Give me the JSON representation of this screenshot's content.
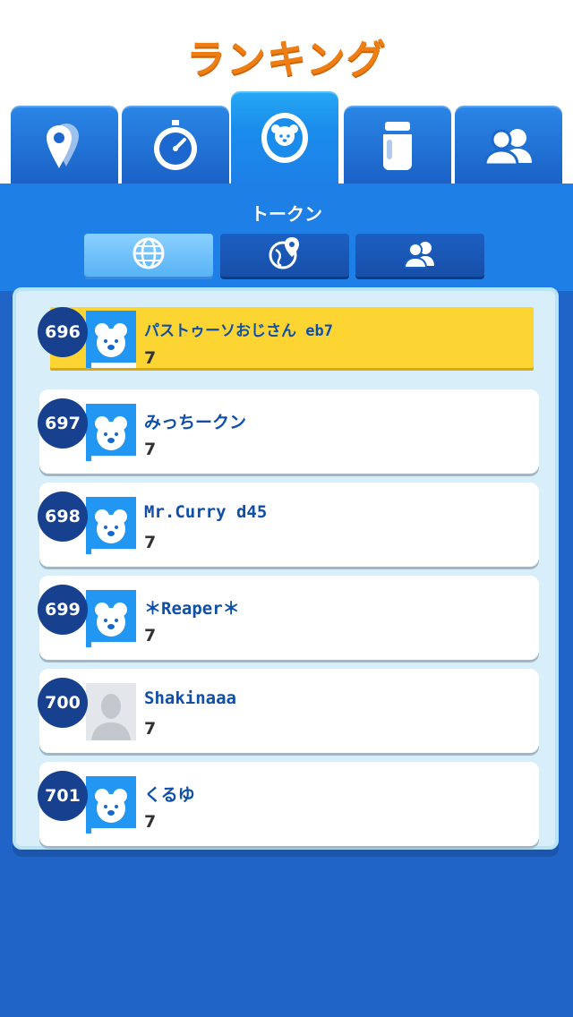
{
  "header": {
    "title": "ランキング"
  },
  "tabs": [
    {
      "icon": "map-pins-icon"
    },
    {
      "icon": "stopwatch-icon"
    },
    {
      "icon": "token-coin-icon",
      "active": true
    },
    {
      "icon": "jar-icon"
    },
    {
      "icon": "friends-icon"
    }
  ],
  "section": {
    "subtitle": "トークン"
  },
  "filters": [
    {
      "icon": "globe-icon",
      "active": true
    },
    {
      "icon": "region-globe-icon"
    },
    {
      "icon": "friends-icon"
    }
  ],
  "ranking": [
    {
      "rank": "696",
      "name": "パストゥーソおじさん eb7",
      "score": "7",
      "highlight": true,
      "avatar": "bear"
    },
    {
      "rank": "697",
      "name": "みっちークン",
      "score": "7",
      "avatar": "bear"
    },
    {
      "rank": "698",
      "name": "Mr.Curry d45",
      "score": "7",
      "avatar": "bear"
    },
    {
      "rank": "699",
      "name": "＊Reaper＊",
      "score": "7",
      "avatar": "bear"
    },
    {
      "rank": "700",
      "name": "Shakinaaa",
      "score": "7",
      "avatar": "silhouette"
    },
    {
      "rank": "701",
      "name": "くるゆ",
      "score": "7",
      "avatar": "bear"
    }
  ],
  "colors": {
    "title": "#ee7d12",
    "tab_blue": "#1e7fe6",
    "rank_circle": "#17408f",
    "highlight": "#fdd532",
    "name_text": "#0f4fa8"
  }
}
